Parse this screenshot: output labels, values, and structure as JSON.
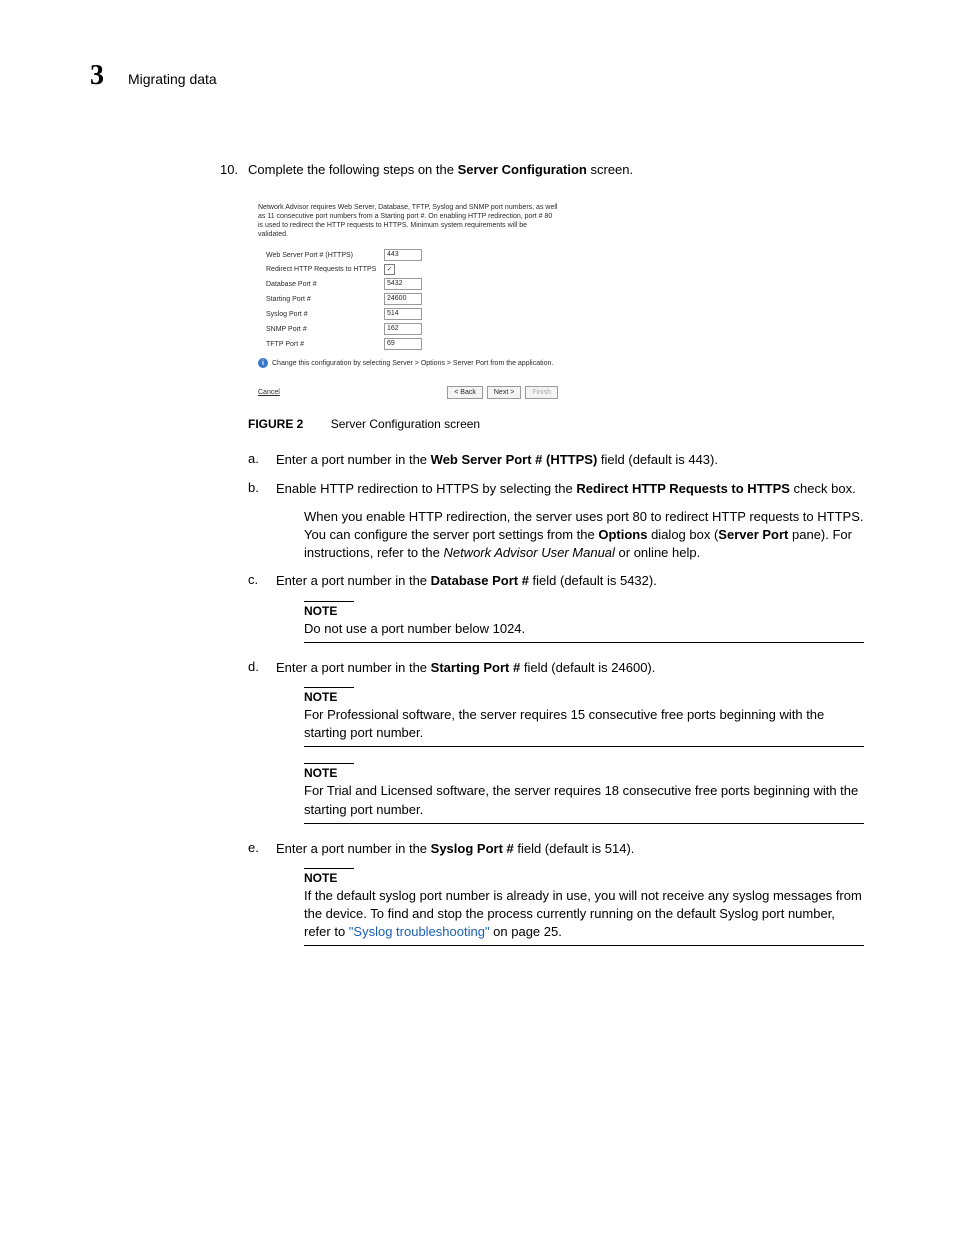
{
  "header": {
    "chapter_number": "3",
    "chapter_title": "Migrating data"
  },
  "step": {
    "number": "10.",
    "text_before": "Complete the following steps on the ",
    "text_bold": "Server Configuration",
    "text_after": " screen."
  },
  "screenshot": {
    "intro": "Network Advisor requires Web Server, Database, TFTP, Syslog and SNMP port numbers, as well as 11 consecutive port numbers from a Starting port #. On enabling HTTP redirection, port # 80 is used to redirect the HTTP requests to HTTPS. Minimum system requirements will be validated.",
    "rows": [
      {
        "label": "Web Server Port # (HTTPS)",
        "value": "443",
        "type": "text"
      },
      {
        "label": "Redirect HTTP Requests to HTTPS",
        "value": "✓",
        "type": "checkbox"
      },
      {
        "label": "Database Port #",
        "value": "5432",
        "type": "text"
      },
      {
        "label": "Starting Port #",
        "value": "24600",
        "type": "text"
      },
      {
        "label": "Syslog Port #",
        "value": "514",
        "type": "text"
      },
      {
        "label": "SNMP Port #",
        "value": "162",
        "type": "text"
      },
      {
        "label": "TFTP Port #",
        "value": "69",
        "type": "text"
      }
    ],
    "info": "Change this configuration by selecting Server > Options > Server Port from the application.",
    "cancel": "Cancel",
    "back": "< Back",
    "next": "Next >",
    "finish": "Finish"
  },
  "figure": {
    "label": "FIGURE 2",
    "caption": "Server Configuration screen"
  },
  "sub_a": {
    "letter": "a.",
    "t1": "Enter a port number in the ",
    "bold": "Web Server Port # (HTTPS)",
    "t2": " field (default is 443)."
  },
  "sub_b": {
    "letter": "b.",
    "t1": "Enable HTTP redirection to HTTPS by selecting the ",
    "bold": "Redirect HTTP Requests to HTTPS",
    "t2": " check box.",
    "para_t1": "When you enable HTTP redirection, the server uses port 80 to redirect HTTP requests to HTTPS. You can configure the server port settings from the ",
    "para_b1": "Options",
    "para_t2": " dialog box (",
    "para_b2": "Server Port",
    "para_t3": " pane). For instructions, refer to the ",
    "para_i1": "Network Advisor User Manual",
    "para_t4": " or online help."
  },
  "sub_c": {
    "letter": "c.",
    "t1": "Enter a port number in the ",
    "bold": "Database Port #",
    "t2": " field (default is 5432)."
  },
  "note_c": {
    "label": "NOTE",
    "body": "Do not use a port number below 1024."
  },
  "sub_d": {
    "letter": "d.",
    "t1": "Enter a port number in the ",
    "bold": "Starting Port #",
    "t2": " field (default is 24600)."
  },
  "note_d1": {
    "label": "NOTE",
    "body": "For Professional software, the server requires 15 consecutive free ports beginning with the starting port number."
  },
  "note_d2": {
    "label": "NOTE",
    "body": "For Trial and Licensed software, the server requires 18 consecutive free ports beginning with the starting port number."
  },
  "sub_e": {
    "letter": "e.",
    "t1": "Enter a port number in the ",
    "bold": "Syslog Port #",
    "t2": " field (default is 514)."
  },
  "note_e": {
    "label": "NOTE",
    "body_t1": "If the default syslog port number is already in use, you will not receive any syslog messages from the device. To find and stop the process currently running on the default Syslog port number, refer to ",
    "link": "\"Syslog troubleshooting\"",
    "body_t2": " on page 25."
  }
}
